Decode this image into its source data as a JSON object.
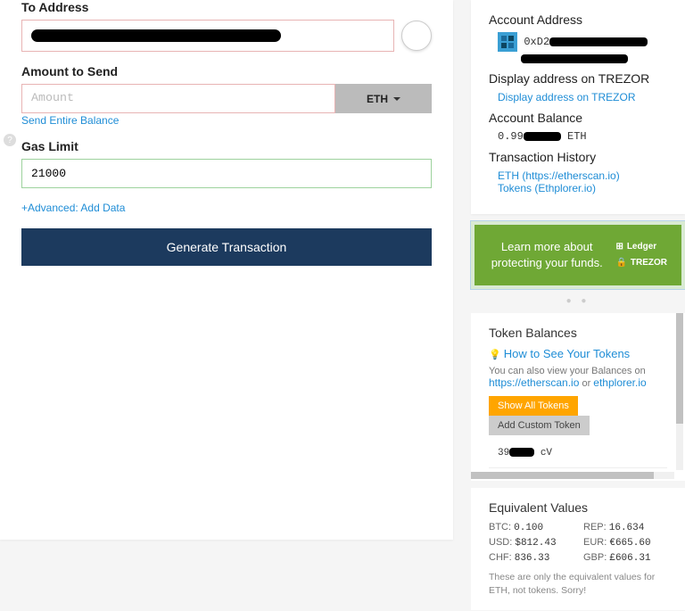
{
  "form": {
    "toAddressLabel": "To Address",
    "toAddressValue": "████████████████████████████████",
    "amountLabel": "Amount to Send",
    "amountPlaceholder": "Amount",
    "currencyLabel": "ETH",
    "sendEntireBalanceLink": "Send Entire Balance",
    "gasLimitLabel": "Gas Limit",
    "gasLimitValue": "21000",
    "advancedLink": "+Advanced: Add Data",
    "generateButton": "Generate Transaction"
  },
  "account": {
    "addressLabel": "Account Address",
    "addressPrefix": "0xD2",
    "displayTrezorLabel": "Display address on TREZOR",
    "displayTrezorLink": "Display address on TREZOR",
    "balanceLabel": "Account Balance",
    "balanceValue": "0.99",
    "balanceUnit": "ETH",
    "historyLabel": "Transaction History",
    "ethLink": "ETH (https://etherscan.io)",
    "tokensLink": "Tokens (Ethplorer.io)"
  },
  "promo": {
    "text": "Learn more about protecting your funds.",
    "logo1": "Ledger",
    "logo2": "TREZOR"
  },
  "tokens": {
    "title": "Token Balances",
    "howToLink": "How to See Your Tokens",
    "viewText": "You can also view your Balances on ",
    "etherscanLink": "https://etherscan.io",
    "orText": " or ",
    "ethplorerLink": "ethplorer.io",
    "showAllBtn": "Show All Tokens",
    "addCustomBtn": "Add Custom Token",
    "balancePrefix": "39",
    "balanceSuffix": "cV"
  },
  "equiv": {
    "title": "Equivalent Values",
    "rows": [
      {
        "label": "BTC:",
        "value": "0.100"
      },
      {
        "label": "REP:",
        "value": "16.634"
      },
      {
        "label": "USD:",
        "value": "$812.43"
      },
      {
        "label": "EUR:",
        "value": "€665.60"
      },
      {
        "label": "CHF:",
        "value": "836.33"
      },
      {
        "label": "GBP:",
        "value": "£606.31"
      }
    ],
    "note": "These are only the equivalent values for ETH, not tokens. Sorry!"
  }
}
